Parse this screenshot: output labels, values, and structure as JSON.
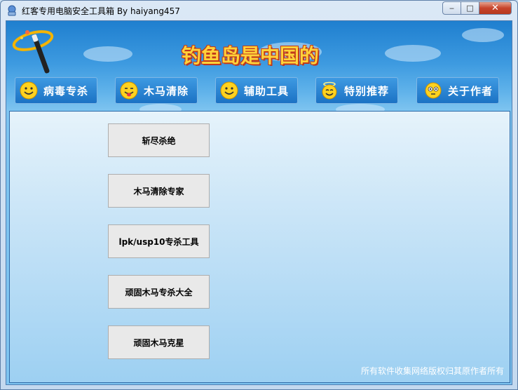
{
  "window": {
    "title": "红客专用电脑安全工具箱  By haiyang457",
    "controls": {
      "minimize": "‒",
      "maximize": "□",
      "close": "✕"
    }
  },
  "banner": {
    "text": "钓鱼岛是中国的"
  },
  "nav": [
    {
      "label": "病毒专杀",
      "icon": "smiley-icon"
    },
    {
      "label": "木马清除",
      "icon": "tongue-face-icon"
    },
    {
      "label": "辅助工具",
      "icon": "smiley-icon"
    },
    {
      "label": "特别推荐",
      "icon": "angel-face-icon"
    },
    {
      "label": "关于作者",
      "icon": "eyes-face-icon"
    }
  ],
  "tools": [
    {
      "label": "斩尽杀绝"
    },
    {
      "label": "木马清除专家"
    },
    {
      "label": "lpk/usp10专杀工具"
    },
    {
      "label": "顽固木马专杀大全"
    },
    {
      "label": "顽固木马克星"
    }
  ],
  "footer": {
    "text": "所有软件收集网络版权归其原作者所有"
  },
  "colors": {
    "banner_text": "#ffd23a",
    "banner_outline": "#c0391b",
    "nav_bg": "#1b72c4"
  }
}
